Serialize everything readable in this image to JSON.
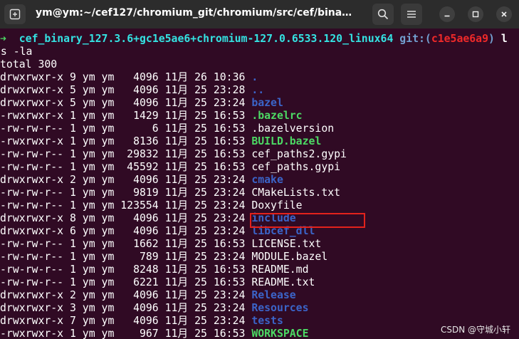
{
  "window": {
    "title": "ym@ym:~/cef127/chromium_git/chromium/src/cef/binary_di..."
  },
  "prompt": {
    "arrow": "➜",
    "dir": "cef_binary_127.3.6+gc1e5ae6+chromium-127.0.6533.120_linux64",
    "git_label": "git:(",
    "branch": "c1e5ae6a9",
    "git_close": ")",
    "after": " l"
  },
  "command": "ls -la",
  "total": "total 300",
  "entries": [
    {
      "meta": "drwxrwxr-x 9 ym ym   4096 11月 26 10:36 ",
      "name": ".",
      "type": "dir"
    },
    {
      "meta": "drwxrwxr-x 5 ym ym   4096 11月 25 23:28 ",
      "name": "..",
      "type": "dir"
    },
    {
      "meta": "drwxrwxr-x 5 ym ym   4096 11月 25 23:24 ",
      "name": "bazel",
      "type": "dir"
    },
    {
      "meta": "-rwxrwxr-x 1 ym ym   1429 11月 25 16:53 ",
      "name": ".bazelrc",
      "type": "exec"
    },
    {
      "meta": "-rw-rw-r-- 1 ym ym      6 11月 25 16:53 ",
      "name": ".bazelversion",
      "type": "plain"
    },
    {
      "meta": "-rwxrwxr-x 1 ym ym   8136 11月 25 16:53 ",
      "name": "BUILD.bazel",
      "type": "exec"
    },
    {
      "meta": "-rw-rw-r-- 1 ym ym  29832 11月 25 16:53 ",
      "name": "cef_paths2.gypi",
      "type": "plain"
    },
    {
      "meta": "-rw-rw-r-- 1 ym ym  45592 11月 25 16:53 ",
      "name": "cef_paths.gypi",
      "type": "plain"
    },
    {
      "meta": "drwxrwxr-x 2 ym ym   4096 11月 25 23:24 ",
      "name": "cmake",
      "type": "dir"
    },
    {
      "meta": "-rw-rw-r-- 1 ym ym   9819 11月 25 23:24 ",
      "name": "CMakeLists.txt",
      "type": "plain"
    },
    {
      "meta": "-rw-rw-r-- 1 ym ym 123554 11月 25 23:24 ",
      "name": "Doxyfile",
      "type": "plain"
    },
    {
      "meta": "drwxrwxr-x 8 ym ym   4096 11月 25 23:24 ",
      "name": "include",
      "type": "dir"
    },
    {
      "meta": "drwxrwxr-x 6 ym ym   4096 11月 25 23:24 ",
      "name": "libcef_dll",
      "type": "dir"
    },
    {
      "meta": "-rw-rw-r-- 1 ym ym   1662 11月 25 16:53 ",
      "name": "LICENSE.txt",
      "type": "plain"
    },
    {
      "meta": "-rw-rw-r-- 1 ym ym    789 11月 25 23:24 ",
      "name": "MODULE.bazel",
      "type": "plain"
    },
    {
      "meta": "-rw-rw-r-- 1 ym ym   8248 11月 25 16:53 ",
      "name": "README.md",
      "type": "plain"
    },
    {
      "meta": "-rw-rw-r-- 1 ym ym   6221 11月 25 16:53 ",
      "name": "README.txt",
      "type": "plain"
    },
    {
      "meta": "drwxrwxr-x 2 ym ym   4096 11月 25 23:24 ",
      "name": "Release",
      "type": "dir"
    },
    {
      "meta": "drwxrwxr-x 3 ym ym   4096 11月 25 23:24 ",
      "name": "Resources",
      "type": "dir"
    },
    {
      "meta": "drwxrwxr-x 7 ym ym   4096 11月 25 23:24 ",
      "name": "tests",
      "type": "dir"
    },
    {
      "meta": "-rwxrwxr-x 1 ym ym    967 11月 25 16:53 ",
      "name": "WORKSPACE",
      "type": "exec"
    }
  ],
  "watermark": "CSDN @守城小轩",
  "colors": {
    "background": "#300a24",
    "titlebar": "#2c2c2c",
    "dir": "#3b64c8",
    "exec": "#4cd964",
    "highlight": "#e3221c"
  },
  "icons": {
    "new_tab": "new-tab-icon",
    "search": "search-icon",
    "menu": "hamburger-menu-icon",
    "minimize": "minimize-icon",
    "maximize": "maximize-icon",
    "close": "close-icon"
  }
}
